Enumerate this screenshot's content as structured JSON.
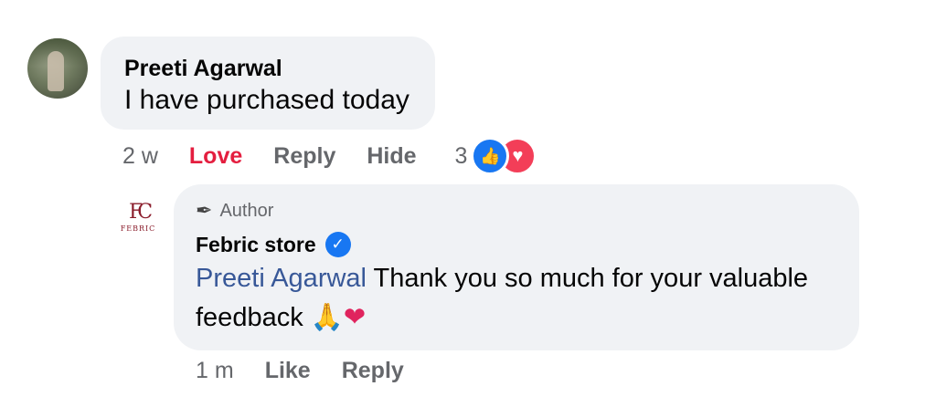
{
  "comment": {
    "author": "Preeti Agarwal",
    "text": "I have purchased today",
    "time": "2 w",
    "actions": {
      "love": "Love",
      "reply": "Reply",
      "hide": "Hide"
    },
    "reaction_count": "3",
    "reaction_icons": [
      "like-icon",
      "heart-icon"
    ],
    "colors": {
      "love": "#e41e3f",
      "like": "#1877f2",
      "heart": "#f33e58"
    }
  },
  "reply": {
    "badge": "Author",
    "author": "Febric store",
    "logo_text": "FEBRIC",
    "mention": "Preeti Agarwal",
    "text": " Thank you so much for your valuable feedback ",
    "emojis": [
      "🙏",
      "❤"
    ],
    "time": "1 m",
    "actions": {
      "like": "Like",
      "reply": "Reply"
    },
    "colors": {
      "mention": "#385898",
      "verified": "#1877f2"
    }
  }
}
